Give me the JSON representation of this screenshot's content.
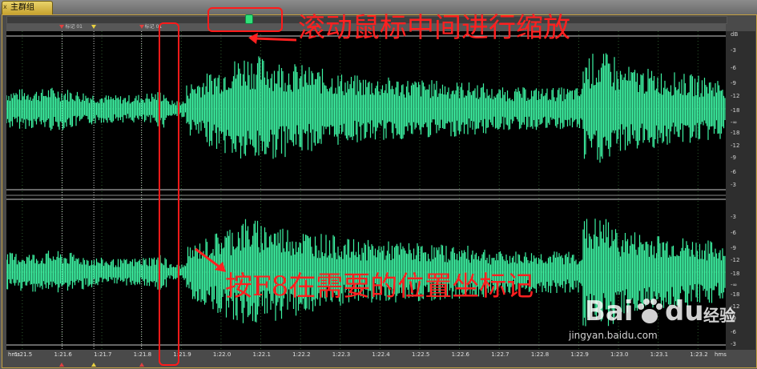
{
  "window": {
    "tab_label": "主群组",
    "tab_close": "x"
  },
  "markers": [
    {
      "label": "标记 01",
      "time": 81.6,
      "color": "#e04040"
    },
    {
      "label": "",
      "time": 81.68,
      "color": "#e8d040"
    },
    {
      "label": "标记 01",
      "time": 81.8,
      "color": "#e04040"
    }
  ],
  "timeline": {
    "unit_left": "hms",
    "unit_right": "hms",
    "ticks": [
      "1:21.5",
      "1:21.6",
      "1:21.7",
      "1:21.8",
      "1:21.9",
      "1:22.0",
      "1:22.1",
      "1:22.2",
      "1:22.3",
      "1:22.4",
      "1:22.5",
      "1:22.6",
      "1:22.7",
      "1:22.8",
      "1:22.9",
      "1:23.0",
      "1:23.1",
      "1:23.2"
    ]
  },
  "db_scale": {
    "unit": "dB",
    "top_channel": [
      "-3",
      "-6",
      "-9",
      "-12",
      "-18",
      "-∞",
      "-18",
      "-12",
      "-9",
      "-6",
      "-3"
    ],
    "bottom_channel": [
      "-3",
      "-6",
      "-9",
      "-12",
      "-18",
      "-∞",
      "-18",
      "-12",
      "-9",
      "-6",
      "-3"
    ]
  },
  "waveform": {
    "color": "#3df2a2",
    "background": "#000000",
    "grid_color": "#2d5a2d"
  },
  "annotations": {
    "scroll_hint": "滚动鼠标中间进行缩放",
    "marker_hint": "按F8在需要的位置坐标记",
    "color": "#ff2020"
  },
  "watermark": {
    "brand": "Bai",
    "brand2": "du",
    "site_cn": "经验",
    "url": "jingyan.baidu.com"
  }
}
